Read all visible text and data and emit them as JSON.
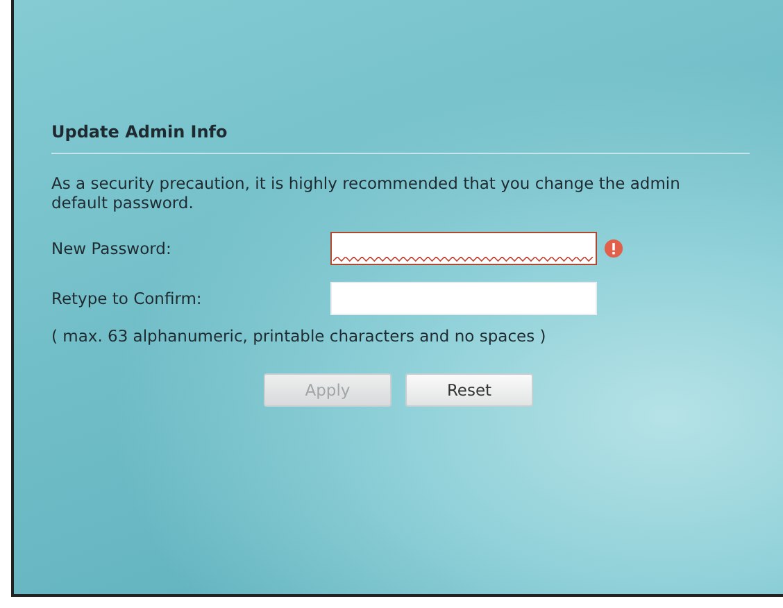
{
  "title": "Update Admin Info",
  "intro": "As a security precaution, it is highly recommended that you change the admin default password.",
  "fields": [
    {
      "label": "New Password:",
      "error": true
    },
    {
      "label": "Retype to Confirm:",
      "error": false
    }
  ],
  "hint": "( max. 63 alphanumeric, printable characters and no spaces )",
  "buttons": [
    {
      "label": "Apply",
      "disabled": true
    },
    {
      "label": "Reset",
      "disabled": false
    }
  ]
}
